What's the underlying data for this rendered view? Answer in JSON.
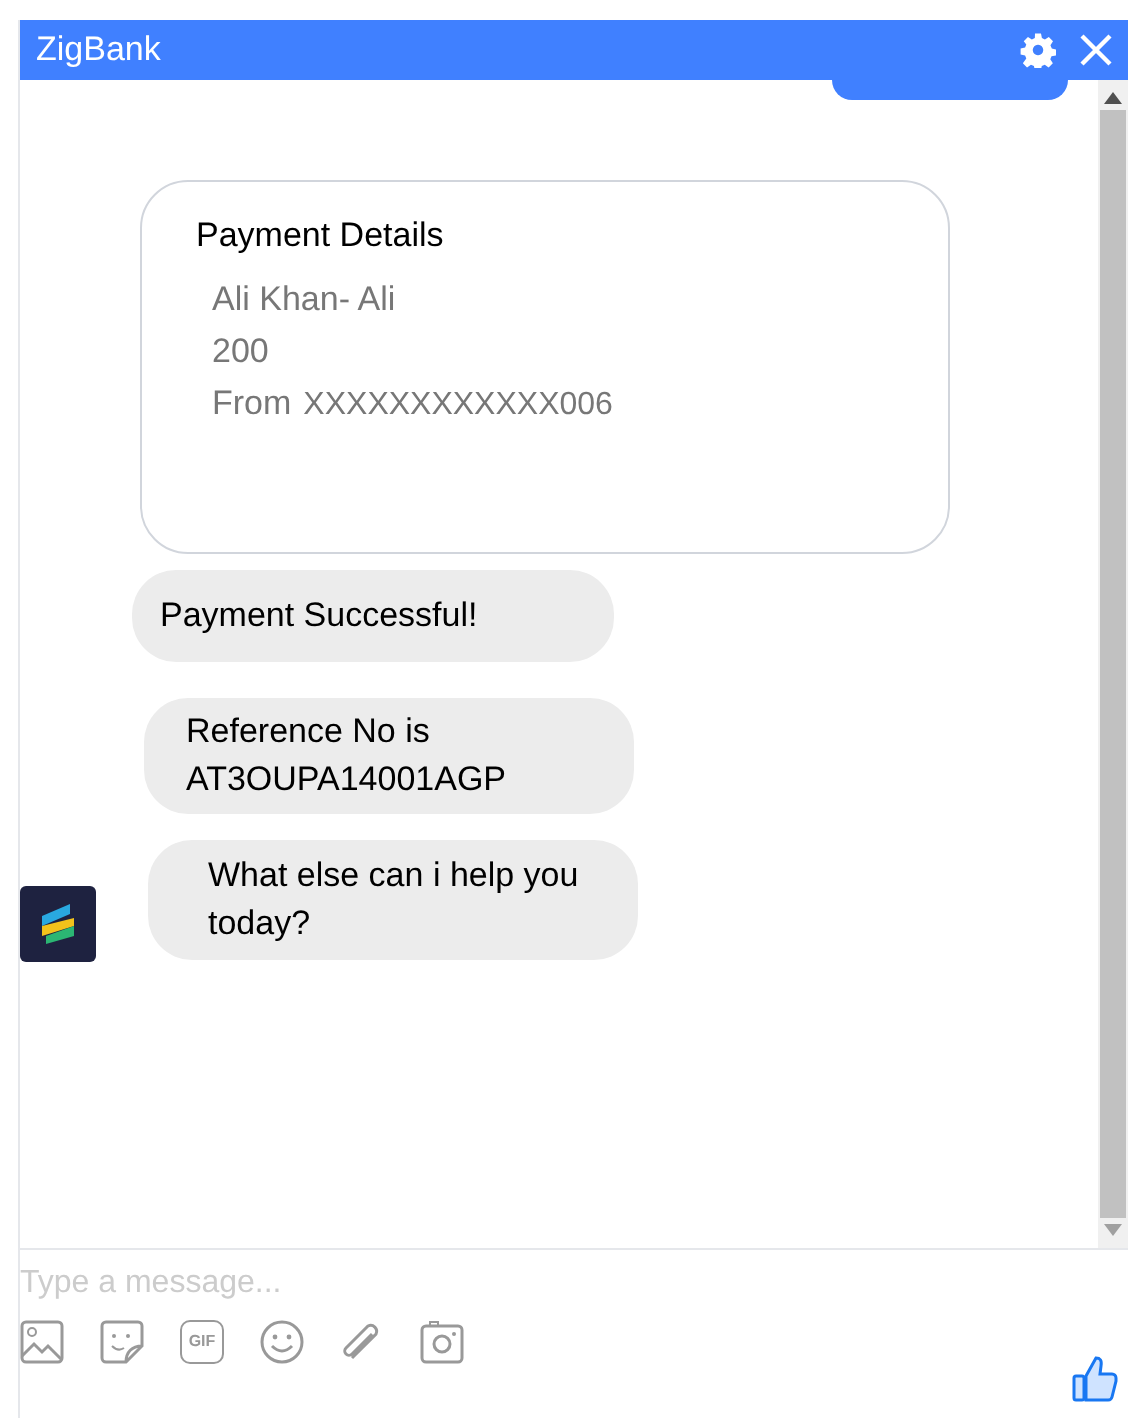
{
  "window": {
    "title": "ZigBank"
  },
  "card": {
    "title": "Payment Details",
    "lines": [
      "Ali Khan- Ali",
      "200"
    ],
    "from_label": "From",
    "from_value": "XXXXXXXXXXXX006"
  },
  "messages": [
    "Payment Successful!",
    "Reference No is AT3OUPA14001AGP",
    "What else can i help you today?"
  ],
  "composer": {
    "placeholder": "Type a message...",
    "gif_label": "GIF"
  }
}
